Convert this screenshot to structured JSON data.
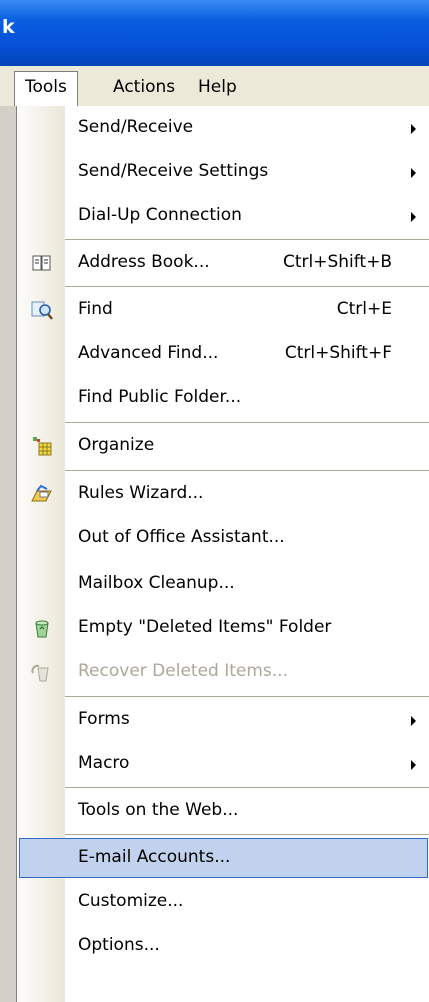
{
  "window": {
    "title": "k"
  },
  "menubar": {
    "items": [
      "Tools",
      "Actions",
      "Help"
    ]
  },
  "tools_menu": {
    "send_receive": "Send/Receive",
    "send_receive_settings": "Send/Receive Settings",
    "dialup": "Dial-Up Connection",
    "address_book": "Address Book...",
    "address_book_shortcut": "Ctrl+Shift+B",
    "find": "Find",
    "find_shortcut": "Ctrl+E",
    "advanced_find": "Advanced Find...",
    "advanced_find_shortcut": "Ctrl+Shift+F",
    "find_public": "Find Public Folder...",
    "organize": "Organize",
    "rules_wizard": "Rules Wizard...",
    "out_of_office": "Out of Office Assistant...",
    "mailbox_cleanup": "Mailbox Cleanup...",
    "empty_deleted": "Empty \"Deleted Items\" Folder",
    "recover_deleted": "Recover Deleted Items...",
    "forms": "Forms",
    "macro": "Macro",
    "tools_web": "Tools on the Web...",
    "email_accounts": "E-mail Accounts...",
    "customize": "Customize...",
    "options": "Options..."
  },
  "colors": {
    "highlight": "#c1d2ee",
    "highlight_border": "#316ac5",
    "titlebar": "#0550d6"
  },
  "icons": {
    "address_book": "address-book-icon",
    "find": "find-icon",
    "organize": "organize-icon",
    "rules": "rules-wizard-icon",
    "empty": "recycle-icon",
    "recover": "recover-icon"
  }
}
